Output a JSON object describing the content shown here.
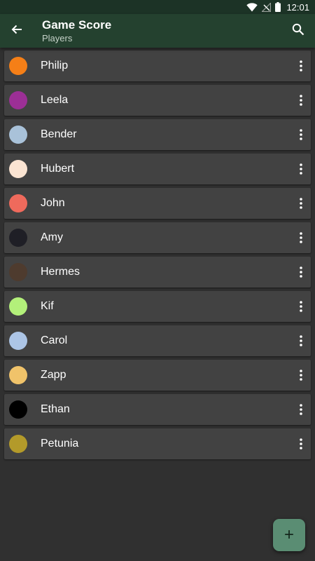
{
  "status_bar": {
    "time": "12:01",
    "icons": [
      "wifi-icon",
      "no-signal-icon",
      "battery-icon"
    ]
  },
  "app_bar": {
    "title": "Game Score",
    "subtitle": "Players",
    "back_icon": "arrow-back-icon",
    "search_icon": "search-icon"
  },
  "players": [
    {
      "name": "Philip",
      "color": "#f57f17"
    },
    {
      "name": "Leela",
      "color": "#9c2f96"
    },
    {
      "name": "Bender",
      "color": "#a9c2d9"
    },
    {
      "name": "Hubert",
      "color": "#fbe4d2"
    },
    {
      "name": "John",
      "color": "#ef6a5c"
    },
    {
      "name": "Amy",
      "color": "#1f1f26"
    },
    {
      "name": "Hermes",
      "color": "#4e3b2e"
    },
    {
      "name": "Kif",
      "color": "#b3f07a"
    },
    {
      "name": "Carol",
      "color": "#acc5e6"
    },
    {
      "name": "Zapp",
      "color": "#f0c36a"
    },
    {
      "name": "Ethan",
      "color": "#000000"
    },
    {
      "name": "Petunia",
      "color": "#b39a2a"
    }
  ],
  "fab": {
    "label": "+",
    "icon": "add-icon"
  },
  "colors": {
    "status_bar": "#1c3326",
    "app_bar": "#24412f",
    "background": "#303030",
    "row": "#424242",
    "fab": "#5a8d73"
  }
}
